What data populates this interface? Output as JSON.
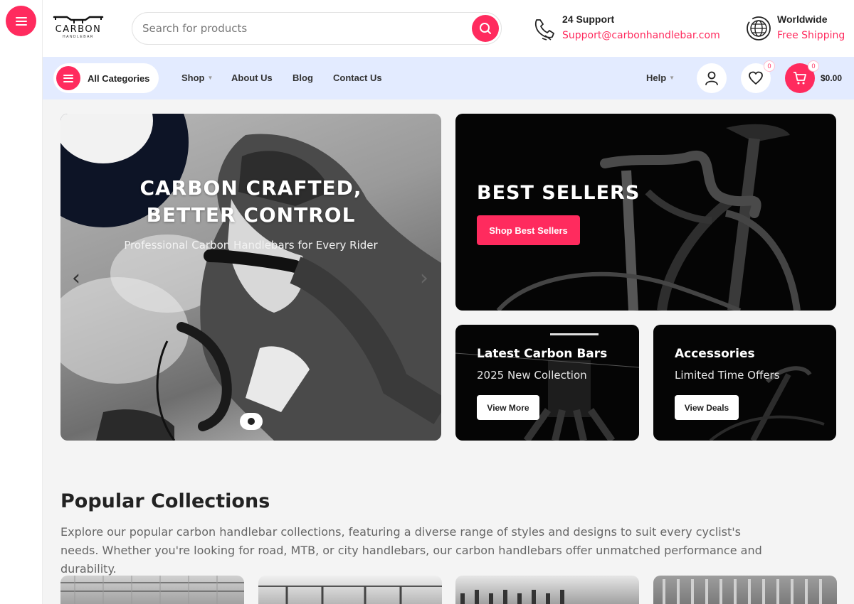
{
  "header": {
    "logo_text": "CARBON",
    "logo_sub": "HANDLEBAR",
    "search_placeholder": "Search for products",
    "support": {
      "title": "24 Support",
      "email": "Support@carbonhandlebar.com"
    },
    "shipping": {
      "title": "Worldwide",
      "subtitle": "Free Shipping"
    }
  },
  "nav": {
    "categories_label": "All Categories",
    "items": [
      "Shop",
      "About Us",
      "Blog",
      "Contact Us"
    ],
    "help_label": "Help",
    "wishlist_count": "0",
    "cart_count": "0",
    "cart_total": "$0.00"
  },
  "hero": {
    "title": "CARBON CRAFTED, BETTER CONTROL",
    "subtitle": "Professional Carbon Handlebars for Every Rider",
    "prev_arrow": "‹",
    "next_arrow": "›"
  },
  "promos": {
    "best_sellers": {
      "title": "BEST SELLERS",
      "button": "Shop Best Sellers"
    },
    "latest": {
      "title": "Latest Carbon Bars",
      "subtitle": "2025 New Collection",
      "button": "View More"
    },
    "accessories": {
      "title": "Accessories",
      "subtitle": "Limited Time Offers",
      "button": "View Deals"
    }
  },
  "collections": {
    "title": "Popular Collections",
    "description": "Explore our popular carbon handlebar collections, featuring a diverse range of styles and designs to suit every cyclist's needs. Whether you're looking for road, MTB, or city handlebars, our carbon handlebars offer unmatched performance and durability."
  },
  "colors": {
    "accent": "#ff2b5e",
    "nav_bg": "#e3ebff",
    "page_bg": "#f4f4f4"
  }
}
